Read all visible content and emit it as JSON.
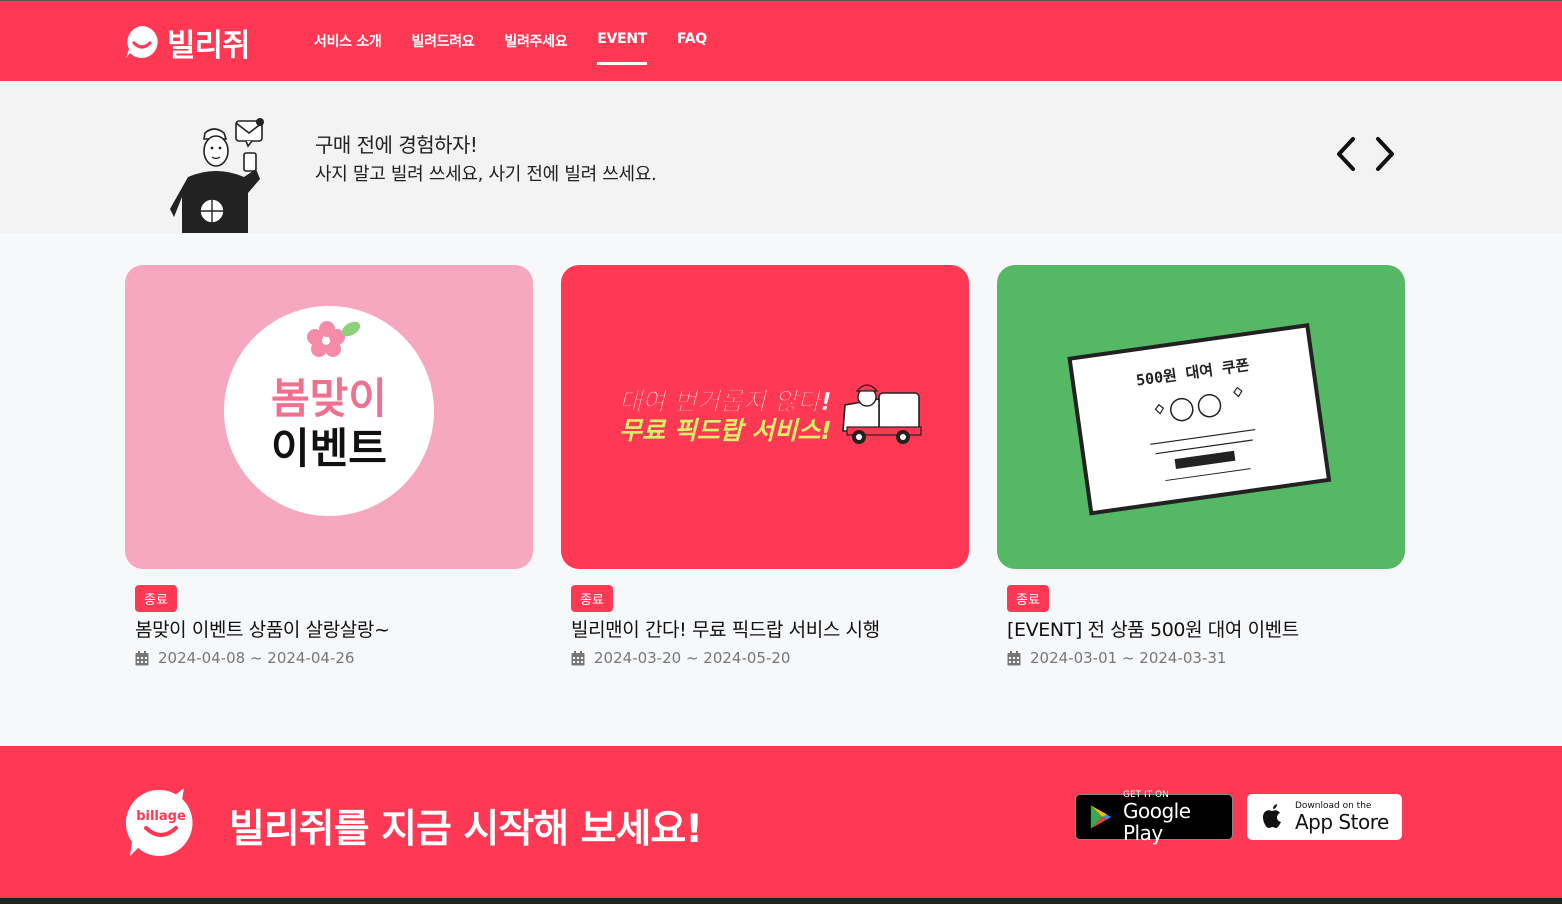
{
  "header": {
    "logo_text": "빌리쥐",
    "nav": [
      {
        "label": "서비스 소개",
        "active": false
      },
      {
        "label": "빌려드려요",
        "active": false
      },
      {
        "label": "빌려주세요",
        "active": false
      },
      {
        "label": "EVENT",
        "active": true
      },
      {
        "label": "FAQ",
        "active": false
      }
    ]
  },
  "banner": {
    "title": "구매 전에 경험하자!",
    "subtitle": "사지 말고 빌려 쓰세요, 사기 전에 빌려 쓰세요."
  },
  "events": [
    {
      "badge": "종료",
      "title": "봄맞이 이벤트 상품이 살랑살랑~",
      "date": "2024-04-08 ~ 2024-04-26",
      "thumb": {
        "line1": "봄맞이",
        "line2": "이벤트"
      }
    },
    {
      "badge": "종료",
      "title": "빌리맨이 간다! 무료 픽드랍 서비스 시행",
      "date": "2024-03-20 ~ 2024-05-20",
      "thumb": {
        "line1": "대여 번거롭지 않다!",
        "line2": "무료 픽드랍 서비스!"
      }
    },
    {
      "badge": "종료",
      "title": "[EVENT] 전 상품 500원 대여 이벤트",
      "date": "2024-03-01 ~ 2024-03-31",
      "thumb": {
        "line1": "500원 대여 쿠폰"
      }
    }
  ],
  "footer": {
    "logo_text": "billage",
    "cta": "빌리쥐를 지금 시작해 보세요!",
    "google_play": {
      "small": "GET IT ON",
      "big": "Google Play"
    },
    "app_store": {
      "small": "Download on the",
      "big": "App Store"
    }
  },
  "colors": {
    "brand": "#ff3853",
    "card1_bg": "#f5a8bf",
    "card2_bg": "#ff3853",
    "card3_bg": "#54b865",
    "banner_bg": "#f3f3f3"
  }
}
